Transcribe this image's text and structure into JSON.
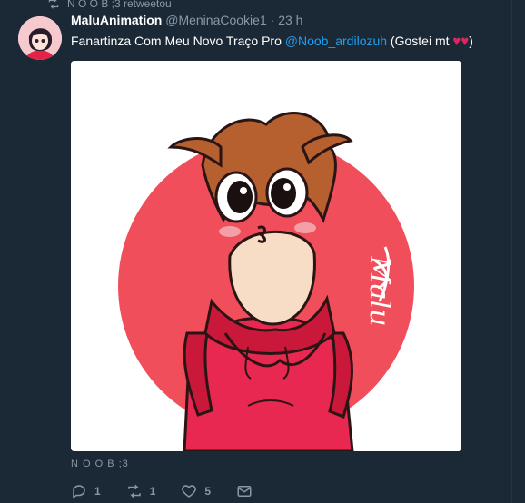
{
  "retweet": {
    "text": "N O O B ;3 retweetou",
    "icon": "retweet-icon"
  },
  "author": {
    "display_name": "MaluAnimation",
    "handle": "@MeninaCookie1",
    "separator": "·",
    "time": "23 h"
  },
  "tweet": {
    "text_before": "Fanartinza Com Meu Novo Traço Pro ",
    "mention": "@Noob_ardilozuh",
    "text_after": " (Gostei mt ",
    "heart1": "♥",
    "heart2": "♥",
    "text_end": ")"
  },
  "media": {
    "signature": "Malu"
  },
  "footer": {
    "label": "N O O B ;3"
  },
  "actions": {
    "reply_count": "1",
    "retweet_count": "1",
    "like_count": "5"
  },
  "colors": {
    "background": "#1b2836",
    "accent": "#1da1f2",
    "muted": "#8899a6",
    "heart": "#e0245e",
    "art_circle": "#f04e5a",
    "art_hoodie": "#c9183a"
  }
}
